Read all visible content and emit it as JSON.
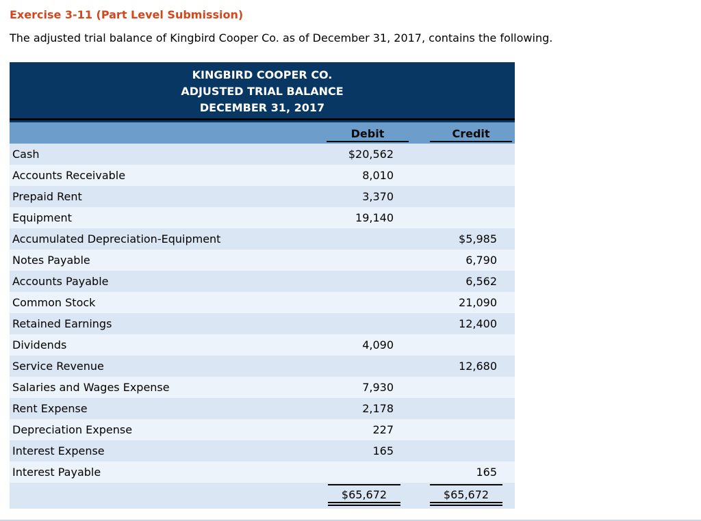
{
  "page": {
    "title": "Exercise 3-11 (Part Level Submission)",
    "intro": "The adjusted trial balance of Kingbird Cooper Co. as of December 31, 2017, contains the following."
  },
  "trial_balance": {
    "company": "KINGBIRD COOPER CO.",
    "statement": "ADJUSTED TRIAL BALANCE",
    "date": "DECEMBER 31, 2017",
    "debit_header": "Debit",
    "credit_header": "Credit",
    "rows": [
      {
        "account": "Cash",
        "debit": "$20,562",
        "credit": ""
      },
      {
        "account": "Accounts Receivable",
        "debit": "8,010",
        "credit": ""
      },
      {
        "account": "Prepaid Rent",
        "debit": "3,370",
        "credit": ""
      },
      {
        "account": "Equipment",
        "debit": "19,140",
        "credit": ""
      },
      {
        "account": "Accumulated Depreciation-Equipment",
        "debit": "",
        "credit": "$5,985"
      },
      {
        "account": "Notes Payable",
        "debit": "",
        "credit": "6,790"
      },
      {
        "account": "Accounts Payable",
        "debit": "",
        "credit": "6,562"
      },
      {
        "account": "Common Stock",
        "debit": "",
        "credit": "21,090"
      },
      {
        "account": "Retained Earnings",
        "debit": "",
        "credit": "12,400"
      },
      {
        "account": "Dividends",
        "debit": "4,090",
        "credit": ""
      },
      {
        "account": "Service Revenue",
        "debit": "",
        "credit": "12,680"
      },
      {
        "account": "Salaries and Wages Expense",
        "debit": "7,930",
        "credit": ""
      },
      {
        "account": "Rent Expense",
        "debit": "2,178",
        "credit": ""
      },
      {
        "account": "Depreciation Expense",
        "debit": "227",
        "credit": ""
      },
      {
        "account": "Interest Expense",
        "debit": "165",
        "credit": ""
      },
      {
        "account": "Interest Payable",
        "debit": "",
        "credit": "165"
      }
    ],
    "totals": {
      "debit": "$65,672",
      "credit": "$65,672"
    }
  },
  "colors": {
    "title_accent": "#d3471c",
    "header_bg": "#083764",
    "band_bg": "#6d9dca",
    "row_odd": "#dbe6f4",
    "row_even": "#ecf3fb",
    "rule": "#000000",
    "bottom_divider": "#ccd6e1"
  }
}
